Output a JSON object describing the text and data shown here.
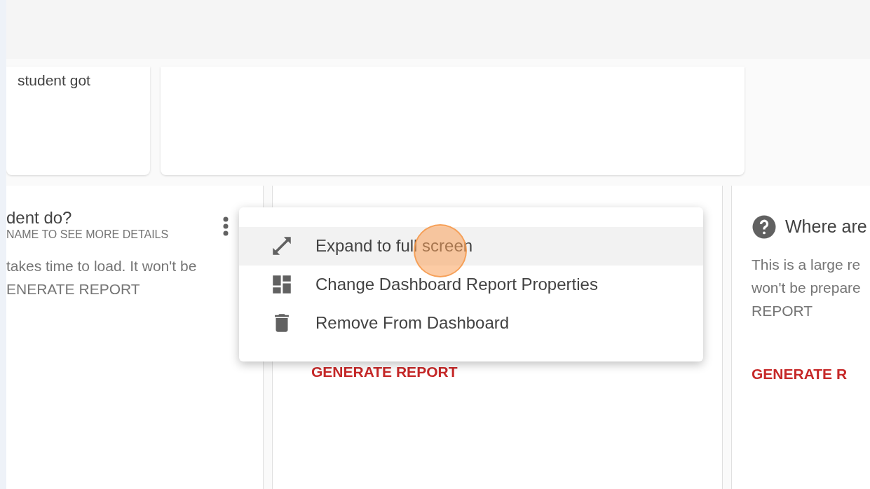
{
  "top_card": {
    "text": "student got"
  },
  "report_cards": [
    {
      "title": "dent do?",
      "subtitle": "NAME TO SEE MORE DETAILS",
      "description_lines": [
        "takes time to load. It won't be",
        "ENERATE REPORT"
      ]
    },
    {
      "action": "GENERATE REPORT"
    },
    {
      "title": "Where are",
      "description_lines": [
        "This is a large re",
        "won't be prepare",
        "REPORT"
      ],
      "action": "GENERATE R"
    }
  ],
  "context_menu": {
    "items": [
      {
        "kind": "expand",
        "label": "Expand to full screen",
        "selected": true
      },
      {
        "kind": "dashboard",
        "label": "Change Dashboard Report Properties",
        "selected": false
      },
      {
        "kind": "delete",
        "label": "Remove From Dashboard",
        "selected": false
      }
    ]
  }
}
